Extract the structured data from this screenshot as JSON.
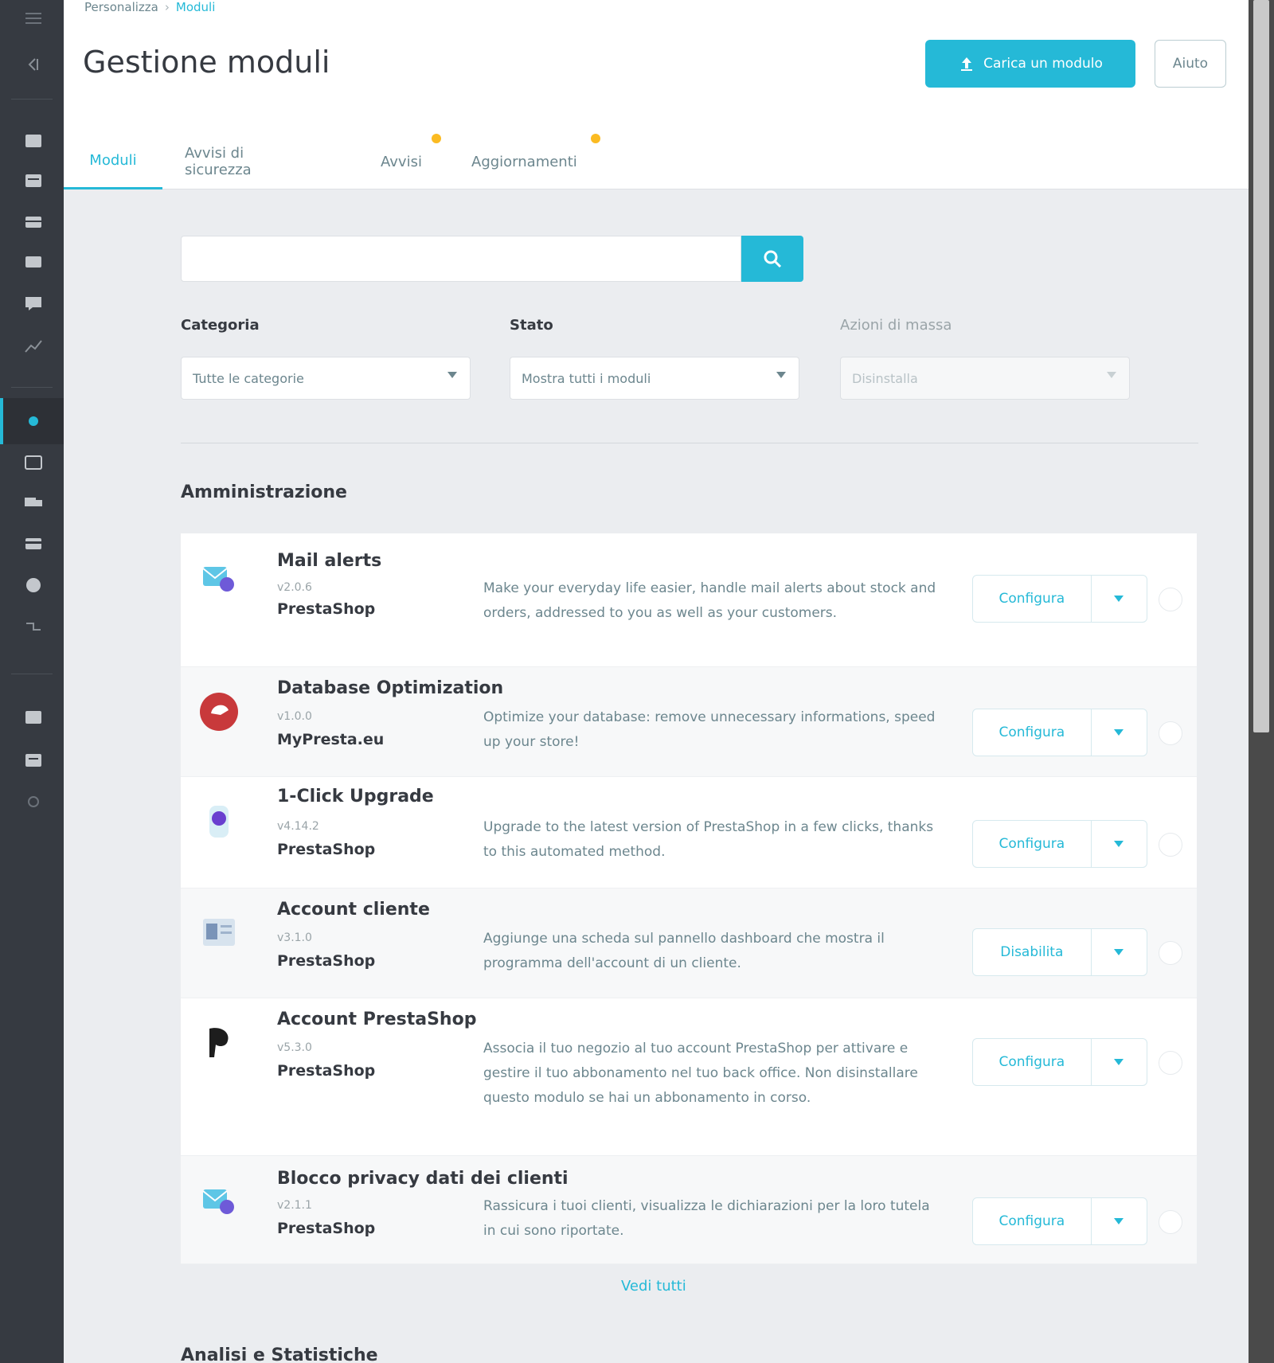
{
  "breadcrumb": {
    "parent": "Personalizza",
    "current": "Moduli"
  },
  "header": {
    "title": "Gestione moduli",
    "upload_label": "Carica un modulo",
    "help_label": "Aiuto"
  },
  "tabs": [
    {
      "label": "Moduli"
    },
    {
      "label": "Avvisi di sicurezza"
    },
    {
      "label": "Avvisi"
    },
    {
      "label": "Aggiornamenti"
    }
  ],
  "search": {
    "placeholder": ""
  },
  "filters": {
    "category": {
      "label": "Categoria",
      "value": "Tutte le categorie"
    },
    "status": {
      "label": "Stato",
      "value": "Mostra tutti i moduli"
    },
    "bulk": {
      "label": "Azioni di massa",
      "value": "Disinstalla"
    }
  },
  "section": {
    "title": "Amministrazione"
  },
  "modules": [
    {
      "name": "Mail alerts",
      "version": "v2.0.6",
      "author": "PrestaShop",
      "description": "Make your everyday life easier, handle mail alerts about stock and orders, addressed to you as well as your customers.",
      "action": "Configura",
      "logo": "mail-alerts-logo"
    },
    {
      "name": "Database Optimization",
      "version": "v1.0.0",
      "author": "MyPresta.eu",
      "description": "Optimize your database: remove unnecessary informations, speed up your store!",
      "action": "Configura",
      "logo": "database-optimization-logo"
    },
    {
      "name": "1-Click Upgrade",
      "version": "v4.14.2",
      "author": "PrestaShop",
      "description": "Upgrade to the latest version of PrestaShop in a few clicks, thanks to this automated method.",
      "action": "Configura",
      "logo": "upgrade-logo"
    },
    {
      "name": "Account cliente",
      "version": "v3.1.0",
      "author": "PrestaShop",
      "description": "Aggiunge una scheda sul pannello dashboard che mostra il programma dell'account di un cliente.",
      "action": "Disabilita",
      "logo": "customer-account-logo"
    },
    {
      "name": "Account PrestaShop",
      "version": "v5.3.0",
      "author": "PrestaShop",
      "description": "Associa il tuo negozio al tuo account PrestaShop per attivare e gestire il tuo abbonamento nel tuo back office. Non disinstallare questo modulo se hai un abbonamento in corso.",
      "action": "Configura",
      "logo": "prestashop-account-logo"
    },
    {
      "name": "Blocco privacy dati dei clienti",
      "version": "v2.1.1",
      "author": "PrestaShop",
      "description": "Rassicura i tuoi clienti, visualizza le dichiarazioni per la loro tutela in cui sono riportate.",
      "action": "Configura",
      "logo": "privacy-logo"
    }
  ],
  "see_all": "Vedi tutti",
  "next_section": {
    "title": "Analisi e Statistiche"
  },
  "colors": {
    "accent": "#25b9d7",
    "sidebar": "#363a41",
    "badge": "#fbbb22"
  },
  "sidebar_icons": [
    "menu-toggle-icon",
    "dashboard-icon",
    "orders-icon",
    "catalog-icon",
    "customers-icon",
    "messages-icon",
    "stats-icon",
    "modules-icon",
    "design-icon",
    "shipping-icon",
    "payment-icon",
    "international-icon",
    "tools-icon",
    "settings-icon",
    "advanced-icon",
    "quick-access-icon"
  ]
}
